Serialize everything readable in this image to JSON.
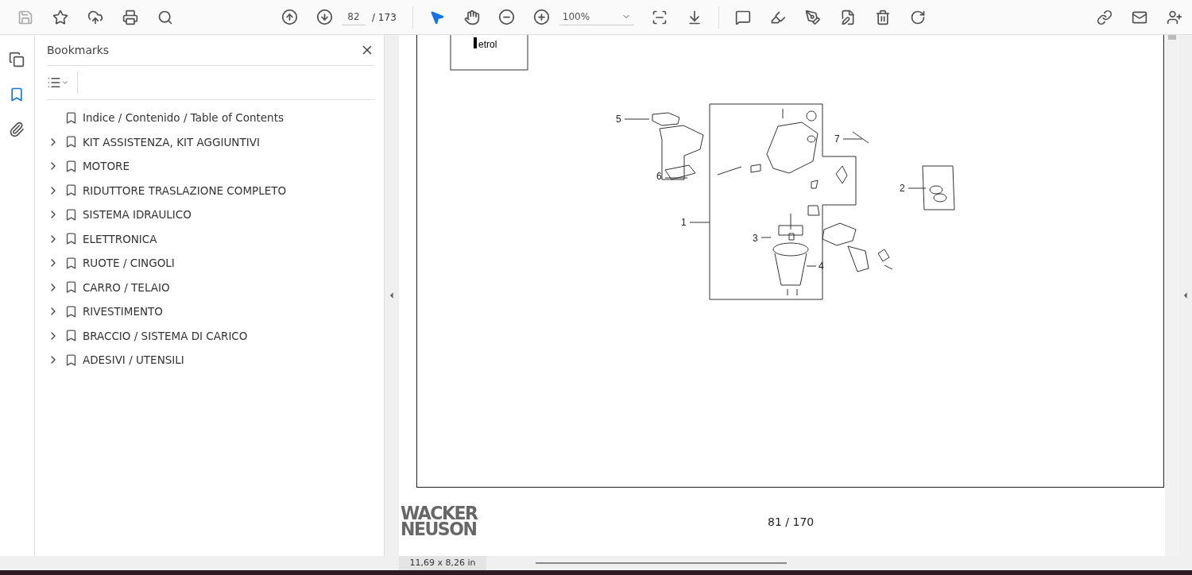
{
  "toolbar": {
    "page_field": {
      "value": "82"
    },
    "page_total": "/ 173",
    "zoom": {
      "value": "100%"
    },
    "tools": [
      {
        "kind": "select",
        "selected": true
      },
      {
        "kind": "hand",
        "selected": false
      }
    ]
  },
  "rail": [
    {
      "kind": "pages",
      "selected": false
    },
    {
      "kind": "bookmarks",
      "selected": true
    },
    {
      "kind": "attachments",
      "selected": false
    }
  ],
  "bookmarks": {
    "title": "Bookmarks",
    "items": [
      {
        "label": "Indice / Contenido / Table of Contents",
        "kind": "leaf"
      },
      {
        "label": "KIT ASSISTENZA, KIT AGGIUNTIVI",
        "kind": "folder"
      },
      {
        "label": "MOTORE",
        "kind": "folder"
      },
      {
        "label": "RIDUTTORE TRASLAZIONE COMPLETO",
        "kind": "folder"
      },
      {
        "label": "SISTEMA IDRAULICO",
        "kind": "folder"
      },
      {
        "label": "ELETTRONICA",
        "kind": "folder"
      },
      {
        "label": "RUOTE / CINGOLI",
        "kind": "folder"
      },
      {
        "label": "CARRO / TELAIO",
        "kind": "folder"
      },
      {
        "label": "RIVESTIMENTO",
        "kind": "folder"
      },
      {
        "label": "BRACCIO / SISTEMA DI CARICO",
        "kind": "folder"
      },
      {
        "label": "ADESIVI / UTENSILI",
        "kind": "folder"
      }
    ]
  },
  "document": {
    "fuel_tag": "etrol",
    "callouts": [
      "5",
      "6",
      "1",
      "3",
      "4",
      "7",
      "2"
    ],
    "logo": [
      "WACKER",
      "NEUSON"
    ],
    "page_number": "81 / 170"
  },
  "status_bar": {
    "page_size": "11,69 x 8,26 in"
  }
}
